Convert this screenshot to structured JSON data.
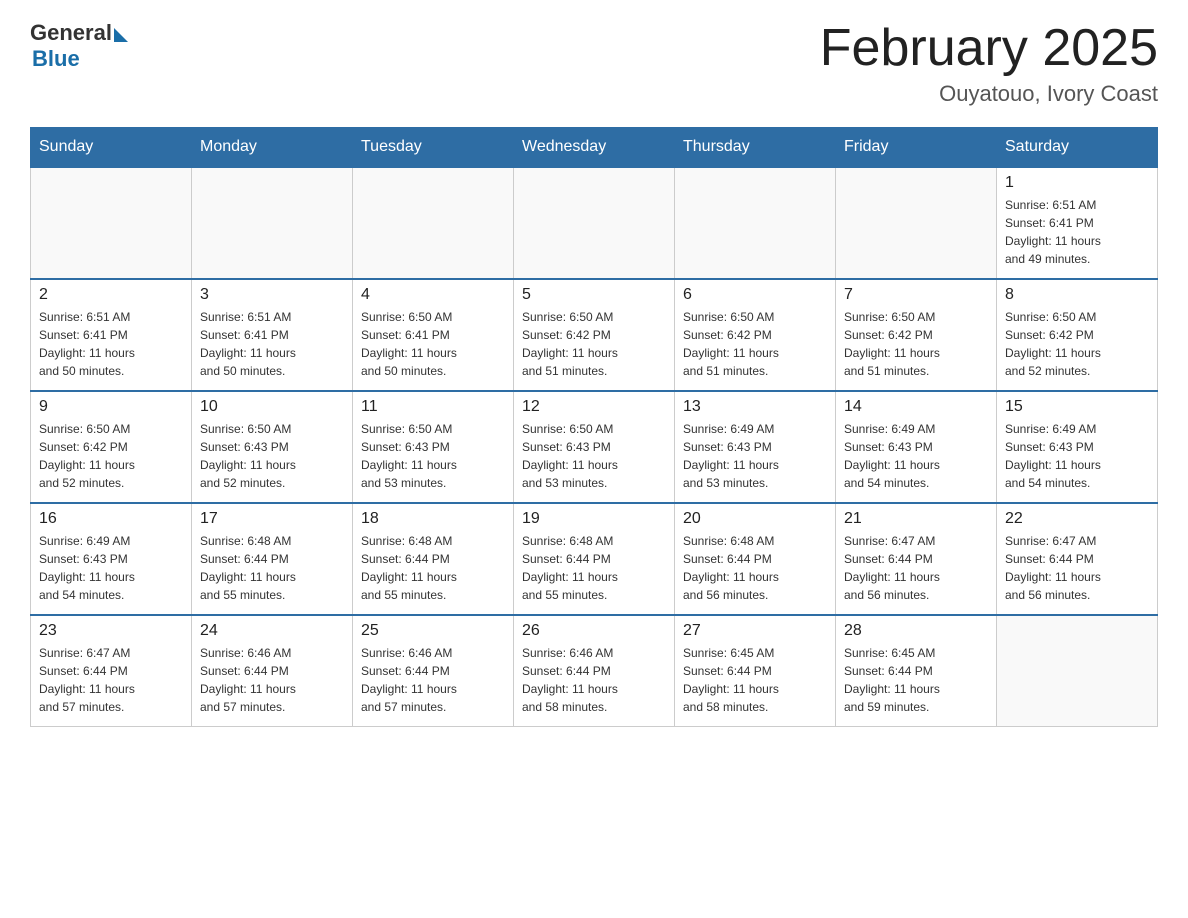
{
  "header": {
    "logo_general": "General",
    "logo_blue": "Blue",
    "month_title": "February 2025",
    "location": "Ouyatouo, Ivory Coast"
  },
  "days_of_week": [
    "Sunday",
    "Monday",
    "Tuesday",
    "Wednesday",
    "Thursday",
    "Friday",
    "Saturday"
  ],
  "weeks": [
    [
      {
        "day": "",
        "info": ""
      },
      {
        "day": "",
        "info": ""
      },
      {
        "day": "",
        "info": ""
      },
      {
        "day": "",
        "info": ""
      },
      {
        "day": "",
        "info": ""
      },
      {
        "day": "",
        "info": ""
      },
      {
        "day": "1",
        "info": "Sunrise: 6:51 AM\nSunset: 6:41 PM\nDaylight: 11 hours\nand 49 minutes."
      }
    ],
    [
      {
        "day": "2",
        "info": "Sunrise: 6:51 AM\nSunset: 6:41 PM\nDaylight: 11 hours\nand 50 minutes."
      },
      {
        "day": "3",
        "info": "Sunrise: 6:51 AM\nSunset: 6:41 PM\nDaylight: 11 hours\nand 50 minutes."
      },
      {
        "day": "4",
        "info": "Sunrise: 6:50 AM\nSunset: 6:41 PM\nDaylight: 11 hours\nand 50 minutes."
      },
      {
        "day": "5",
        "info": "Sunrise: 6:50 AM\nSunset: 6:42 PM\nDaylight: 11 hours\nand 51 minutes."
      },
      {
        "day": "6",
        "info": "Sunrise: 6:50 AM\nSunset: 6:42 PM\nDaylight: 11 hours\nand 51 minutes."
      },
      {
        "day": "7",
        "info": "Sunrise: 6:50 AM\nSunset: 6:42 PM\nDaylight: 11 hours\nand 51 minutes."
      },
      {
        "day": "8",
        "info": "Sunrise: 6:50 AM\nSunset: 6:42 PM\nDaylight: 11 hours\nand 52 minutes."
      }
    ],
    [
      {
        "day": "9",
        "info": "Sunrise: 6:50 AM\nSunset: 6:42 PM\nDaylight: 11 hours\nand 52 minutes."
      },
      {
        "day": "10",
        "info": "Sunrise: 6:50 AM\nSunset: 6:43 PM\nDaylight: 11 hours\nand 52 minutes."
      },
      {
        "day": "11",
        "info": "Sunrise: 6:50 AM\nSunset: 6:43 PM\nDaylight: 11 hours\nand 53 minutes."
      },
      {
        "day": "12",
        "info": "Sunrise: 6:50 AM\nSunset: 6:43 PM\nDaylight: 11 hours\nand 53 minutes."
      },
      {
        "day": "13",
        "info": "Sunrise: 6:49 AM\nSunset: 6:43 PM\nDaylight: 11 hours\nand 53 minutes."
      },
      {
        "day": "14",
        "info": "Sunrise: 6:49 AM\nSunset: 6:43 PM\nDaylight: 11 hours\nand 54 minutes."
      },
      {
        "day": "15",
        "info": "Sunrise: 6:49 AM\nSunset: 6:43 PM\nDaylight: 11 hours\nand 54 minutes."
      }
    ],
    [
      {
        "day": "16",
        "info": "Sunrise: 6:49 AM\nSunset: 6:43 PM\nDaylight: 11 hours\nand 54 minutes."
      },
      {
        "day": "17",
        "info": "Sunrise: 6:48 AM\nSunset: 6:44 PM\nDaylight: 11 hours\nand 55 minutes."
      },
      {
        "day": "18",
        "info": "Sunrise: 6:48 AM\nSunset: 6:44 PM\nDaylight: 11 hours\nand 55 minutes."
      },
      {
        "day": "19",
        "info": "Sunrise: 6:48 AM\nSunset: 6:44 PM\nDaylight: 11 hours\nand 55 minutes."
      },
      {
        "day": "20",
        "info": "Sunrise: 6:48 AM\nSunset: 6:44 PM\nDaylight: 11 hours\nand 56 minutes."
      },
      {
        "day": "21",
        "info": "Sunrise: 6:47 AM\nSunset: 6:44 PM\nDaylight: 11 hours\nand 56 minutes."
      },
      {
        "day": "22",
        "info": "Sunrise: 6:47 AM\nSunset: 6:44 PM\nDaylight: 11 hours\nand 56 minutes."
      }
    ],
    [
      {
        "day": "23",
        "info": "Sunrise: 6:47 AM\nSunset: 6:44 PM\nDaylight: 11 hours\nand 57 minutes."
      },
      {
        "day": "24",
        "info": "Sunrise: 6:46 AM\nSunset: 6:44 PM\nDaylight: 11 hours\nand 57 minutes."
      },
      {
        "day": "25",
        "info": "Sunrise: 6:46 AM\nSunset: 6:44 PM\nDaylight: 11 hours\nand 57 minutes."
      },
      {
        "day": "26",
        "info": "Sunrise: 6:46 AM\nSunset: 6:44 PM\nDaylight: 11 hours\nand 58 minutes."
      },
      {
        "day": "27",
        "info": "Sunrise: 6:45 AM\nSunset: 6:44 PM\nDaylight: 11 hours\nand 58 minutes."
      },
      {
        "day": "28",
        "info": "Sunrise: 6:45 AM\nSunset: 6:44 PM\nDaylight: 11 hours\nand 59 minutes."
      },
      {
        "day": "",
        "info": ""
      }
    ]
  ]
}
